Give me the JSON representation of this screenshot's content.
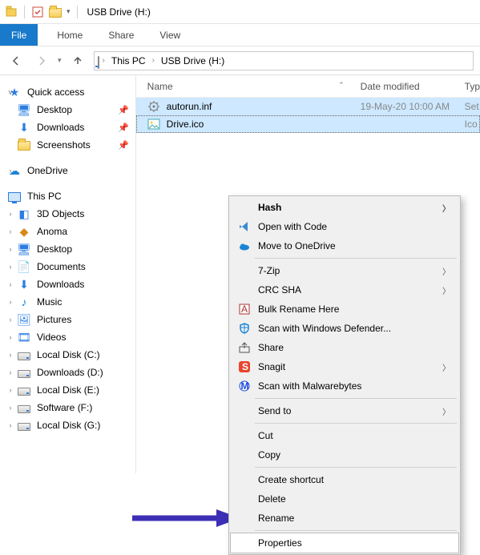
{
  "title": "USB Drive (H:)",
  "ribbon": {
    "file": "File",
    "tabs": [
      "Home",
      "Share",
      "View"
    ]
  },
  "breadcrumb": {
    "root": "This PC",
    "leaf": "USB Drive (H:)"
  },
  "columns": {
    "name": "Name",
    "date": "Date modified",
    "type": "Typ"
  },
  "files": [
    {
      "name": "autorun.inf",
      "date": "19-May-20 10:00 AM",
      "type": "Set",
      "selected": true,
      "focus": false,
      "icon": "gear"
    },
    {
      "name": "Drive.ico",
      "date": "",
      "type": "Ico",
      "selected": true,
      "focus": true,
      "icon": "image"
    }
  ],
  "nav": {
    "quick": {
      "label": "Quick access",
      "items": [
        {
          "label": "Desktop",
          "pinned": true,
          "icon": "desktop"
        },
        {
          "label": "Downloads",
          "pinned": true,
          "icon": "downloads"
        },
        {
          "label": "Screenshots",
          "pinned": true,
          "icon": "folder"
        }
      ]
    },
    "onedrive": {
      "label": "OneDrive"
    },
    "thispc": {
      "label": "This PC",
      "items": [
        {
          "label": "3D Objects",
          "icon": "folder3d"
        },
        {
          "label": "Anoma",
          "icon": "anoma"
        },
        {
          "label": "Desktop",
          "icon": "desktop"
        },
        {
          "label": "Documents",
          "icon": "documents"
        },
        {
          "label": "Downloads",
          "icon": "downloads"
        },
        {
          "label": "Music",
          "icon": "music"
        },
        {
          "label": "Pictures",
          "icon": "pictures"
        },
        {
          "label": "Videos",
          "icon": "videos"
        },
        {
          "label": "Local Disk (C:)",
          "icon": "disk"
        },
        {
          "label": "Downloads  (D:)",
          "icon": "disk"
        },
        {
          "label": "Local Disk (E:)",
          "icon": "disk"
        },
        {
          "label": "Software (F:)",
          "icon": "disk"
        },
        {
          "label": "Local Disk (G:)",
          "icon": "disk"
        }
      ]
    }
  },
  "context_menu": [
    {
      "label": "Hash",
      "type": "item",
      "bold": true,
      "submenu": true,
      "icon": ""
    },
    {
      "label": "Open with Code",
      "type": "item",
      "icon": "vscode"
    },
    {
      "label": "Move to OneDrive",
      "type": "item",
      "icon": "onedrive"
    },
    {
      "type": "sep"
    },
    {
      "label": "7-Zip",
      "type": "item",
      "submenu": true
    },
    {
      "label": "CRC SHA",
      "type": "item",
      "submenu": true
    },
    {
      "label": "Bulk Rename Here",
      "type": "item",
      "icon": "brh"
    },
    {
      "label": "Scan with Windows Defender...",
      "type": "item",
      "icon": "defender"
    },
    {
      "label": "Share",
      "type": "item",
      "icon": "share"
    },
    {
      "label": "Snagit",
      "type": "item",
      "submenu": true,
      "icon": "snagit"
    },
    {
      "label": "Scan with Malwarebytes",
      "type": "item",
      "icon": "mbytes"
    },
    {
      "type": "sep"
    },
    {
      "label": "Send to",
      "type": "item",
      "submenu": true
    },
    {
      "type": "sep"
    },
    {
      "label": "Cut",
      "type": "item"
    },
    {
      "label": "Copy",
      "type": "item"
    },
    {
      "type": "sep"
    },
    {
      "label": "Create shortcut",
      "type": "item"
    },
    {
      "label": "Delete",
      "type": "item"
    },
    {
      "label": "Rename",
      "type": "item"
    },
    {
      "type": "sep"
    },
    {
      "label": "Properties",
      "type": "item",
      "hover": true
    }
  ],
  "annotation": {
    "arrow_color": "#3c2fb5"
  }
}
